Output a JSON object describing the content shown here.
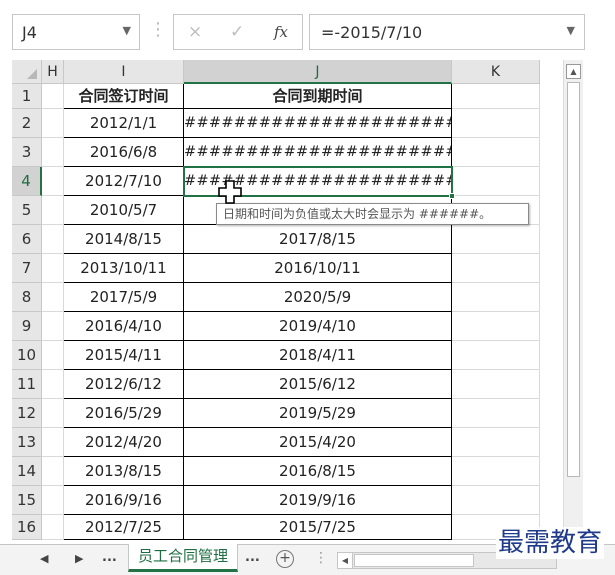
{
  "formula_bar": {
    "name_box": "J4",
    "cancel_icon": "×",
    "enter_icon": "✓",
    "fx_label": "fx",
    "formula": "=-2015/7/10"
  },
  "columns": [
    "H",
    "I",
    "J",
    "K"
  ],
  "selected_column": "J",
  "selected_row": "4",
  "rows": [
    {
      "num": "1",
      "I": "合同签订时间",
      "J": "合同到期时间"
    },
    {
      "num": "2",
      "I": "2012/1/1",
      "J": "#######################"
    },
    {
      "num": "3",
      "I": "2016/6/8",
      "J": "#######################"
    },
    {
      "num": "4",
      "I": "2012/7/10",
      "J": "#######################"
    },
    {
      "num": "5",
      "I": "2010/5/7",
      "J": ""
    },
    {
      "num": "6",
      "I": "2014/8/15",
      "J": "2017/8/15"
    },
    {
      "num": "7",
      "I": "2013/10/11",
      "J": "2016/10/11"
    },
    {
      "num": "8",
      "I": "2017/5/9",
      "J": "2020/5/9"
    },
    {
      "num": "9",
      "I": "2016/4/10",
      "J": "2019/4/10"
    },
    {
      "num": "10",
      "I": "2015/4/11",
      "J": "2018/4/11"
    },
    {
      "num": "11",
      "I": "2012/6/12",
      "J": "2015/6/12"
    },
    {
      "num": "12",
      "I": "2016/5/29",
      "J": "2019/5/29"
    },
    {
      "num": "13",
      "I": "2012/4/20",
      "J": "2015/4/20"
    },
    {
      "num": "14",
      "I": "2013/8/15",
      "J": "2016/8/15"
    },
    {
      "num": "15",
      "I": "2016/9/16",
      "J": "2019/9/16"
    },
    {
      "num": "16",
      "I": "2012/7/25",
      "J": "2015/7/25"
    }
  ],
  "tooltip": "日期和时间为负值或太大时会显示为 ######。",
  "tab_bar": {
    "prev": "◀",
    "next": "▶",
    "more_left": "...",
    "sheet_name": "员工合同管理",
    "more_right": "...",
    "add": "+",
    "separator": "⋮"
  },
  "watermark": "最需教育",
  "colors": {
    "accent": "#217346",
    "header_bg": "#e6e6e6",
    "grid_line": "#d9d9d9"
  }
}
